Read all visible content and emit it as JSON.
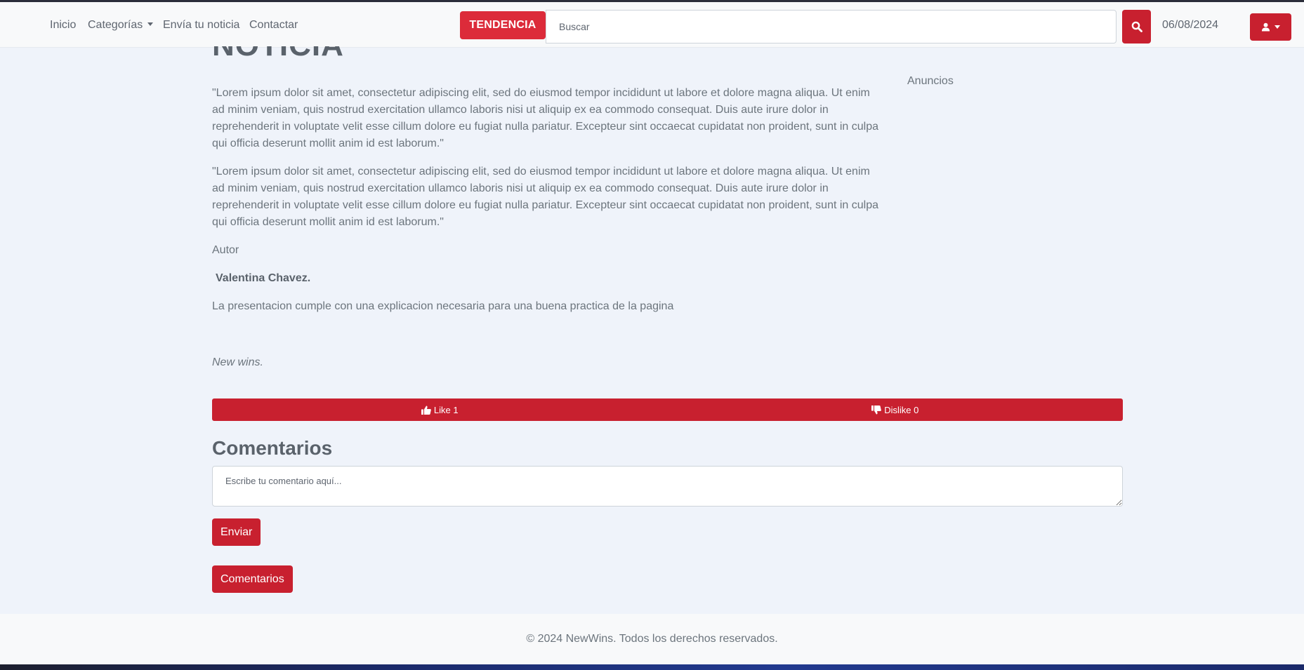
{
  "nav": {
    "links": [
      "Inicio",
      "Categorías",
      "Envía tu noticia",
      "Contactar"
    ],
    "trend_label": "TENDENCIA",
    "search_placeholder": "Buscar",
    "date": "06/08/2024"
  },
  "article": {
    "title": "NOTICIA",
    "paragraphs": [
      "\"Lorem ipsum dolor sit amet, consectetur adipiscing elit, sed do eiusmod tempor incididunt ut labore et dolore magna aliqua. Ut enim ad minim veniam, quis nostrud exercitation ullamco laboris nisi ut aliquip ex ea commodo consequat. Duis aute irure dolor in reprehenderit in voluptate velit esse cillum dolore eu fugiat nulla pariatur. Excepteur sint occaecat cupidatat non proident, sunt in culpa qui officia deserunt mollit anim id est laborum.\"",
      "\"Lorem ipsum dolor sit amet, consectetur adipiscing elit, sed do eiusmod tempor incididunt ut labore et dolore magna aliqua. Ut enim ad minim veniam, quis nostrud exercitation ullamco laboris nisi ut aliquip ex ea commodo consequat. Duis aute irure dolor in reprehenderit in voluptate velit esse cillum dolore eu fugiat nulla pariatur. Excepteur sint occaecat cupidatat non proident, sunt in culpa qui officia deserunt mollit anim id est laborum.\""
    ],
    "author_label": "Autor",
    "author_name": "Valentina Chavez.",
    "note": "La presentacion cumple con una explicacion necesaria para una buena practica de la pagina",
    "source": "New wins."
  },
  "sidebar": {
    "ads_label": "Anuncios"
  },
  "reactions": {
    "like_label": "Like 1",
    "dislike_label": "Dislike 0"
  },
  "comments": {
    "title": "Comentarios",
    "placeholder": "Escribe tu comentario aquí...",
    "submit_label": "Enviar",
    "toggle_label": "Comentarios"
  },
  "footer": {
    "text": "© 2024 NewWins. Todos los derechos reservados."
  },
  "colors": {
    "brand_red": "#c8202f",
    "trend_red": "#dc2b3a",
    "page_bg": "#eff3fa"
  }
}
